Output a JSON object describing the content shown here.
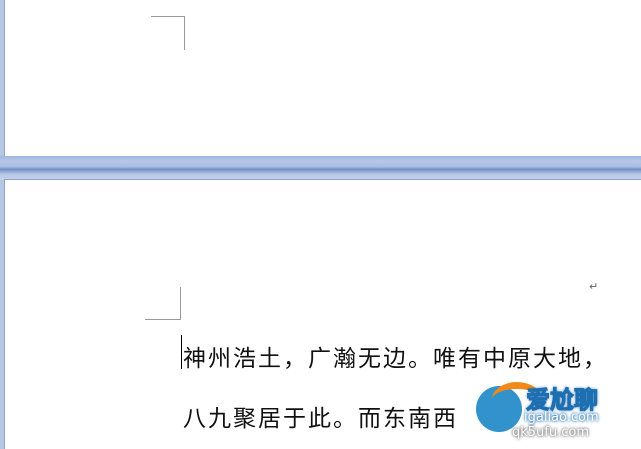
{
  "document": {
    "paragraph_mark": "↵",
    "lines": [
      "神州浩土，广瀚无边。唯有中原大地，",
      "八九聚居于此。而东南西"
    ]
  },
  "watermark": {
    "brand_cn": "爱尬聊",
    "url": "igaliao.com",
    "url_alt": "qk5ufu.com"
  },
  "colors": {
    "workspace_bg": "#b7c8e6",
    "page_bg": "#ffffff",
    "text": "#111111"
  }
}
